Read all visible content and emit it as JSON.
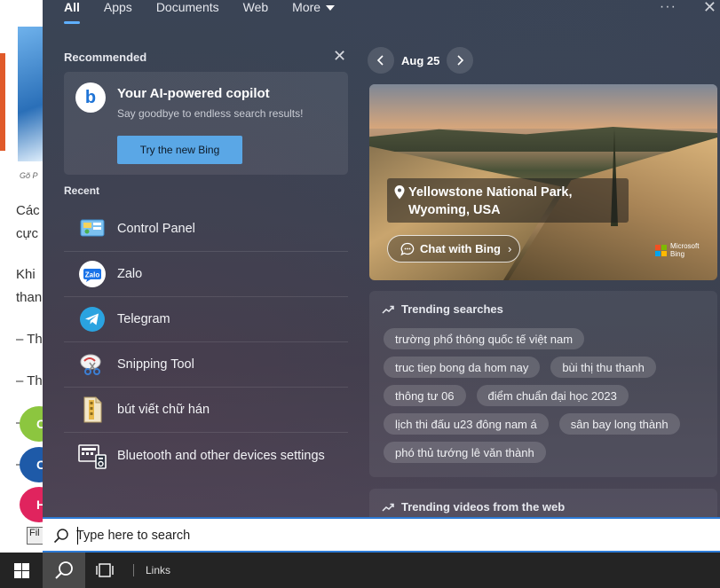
{
  "background_page": {
    "caption": "Gõ P",
    "lines": [
      "Các",
      "cực",
      "Khi",
      "than",
      "– Th",
      "– Th",
      "–",
      "–"
    ],
    "circles": [
      {
        "letter": "C",
        "color": "#8cc63f"
      },
      {
        "letter": "C",
        "color": "#1e5aa8"
      },
      {
        "letter": "H",
        "color": "#e0245e"
      }
    ],
    "file_button": "Fil"
  },
  "tabs": [
    {
      "label": "All",
      "active": true
    },
    {
      "label": "Apps"
    },
    {
      "label": "Documents"
    },
    {
      "label": "Web"
    },
    {
      "label": "More"
    }
  ],
  "top_icons": {
    "more": "more-options-icon",
    "close": "close-icon"
  },
  "recommended": {
    "heading": "Recommended",
    "card": {
      "logo_letter": "b",
      "title": "Your AI-powered copilot",
      "subtitle": "Say goodbye to endless search results!",
      "button": "Try the new Bing"
    }
  },
  "recent": {
    "heading": "Recent",
    "items": [
      {
        "label": "Control Panel",
        "icon": "control-panel-icon"
      },
      {
        "label": "Zalo",
        "icon": "zalo-icon"
      },
      {
        "label": "Telegram",
        "icon": "telegram-icon"
      },
      {
        "label": "Snipping Tool",
        "icon": "snipping-tool-icon"
      },
      {
        "label": "bút viết chữ hán",
        "icon": "file-icon"
      },
      {
        "label": "Bluetooth and other devices settings",
        "icon": "bluetooth-devices-icon"
      }
    ]
  },
  "daily": {
    "date": "Aug 25",
    "location_line1": "Yellowstone National Park,",
    "location_line2": "Wyoming, USA",
    "chat_button": "Chat with Bing",
    "brand_line1": "Microsoft",
    "brand_line2": "Bing",
    "brand_colors": [
      "#f25022",
      "#7fba00",
      "#00a4ef",
      "#ffb900"
    ]
  },
  "trending": {
    "heading": "Trending searches",
    "chips": [
      "trường phổ thông quốc tế việt nam",
      "truc tiep bong da hom nay",
      "bùi thị thu thanh",
      "thông tư 06",
      "điểm chuẩn đại học 2023",
      "lịch thi đấu u23 đông nam á",
      "sân bay long thành",
      "phó thủ tướng lê văn thành"
    ]
  },
  "videos": {
    "heading": "Trending videos from the web"
  },
  "search": {
    "placeholder": "Type here to search"
  },
  "taskbar": {
    "links_label": "Links"
  },
  "colors": {
    "accent": "#2d7bd6",
    "button": "#5aa7e6"
  }
}
